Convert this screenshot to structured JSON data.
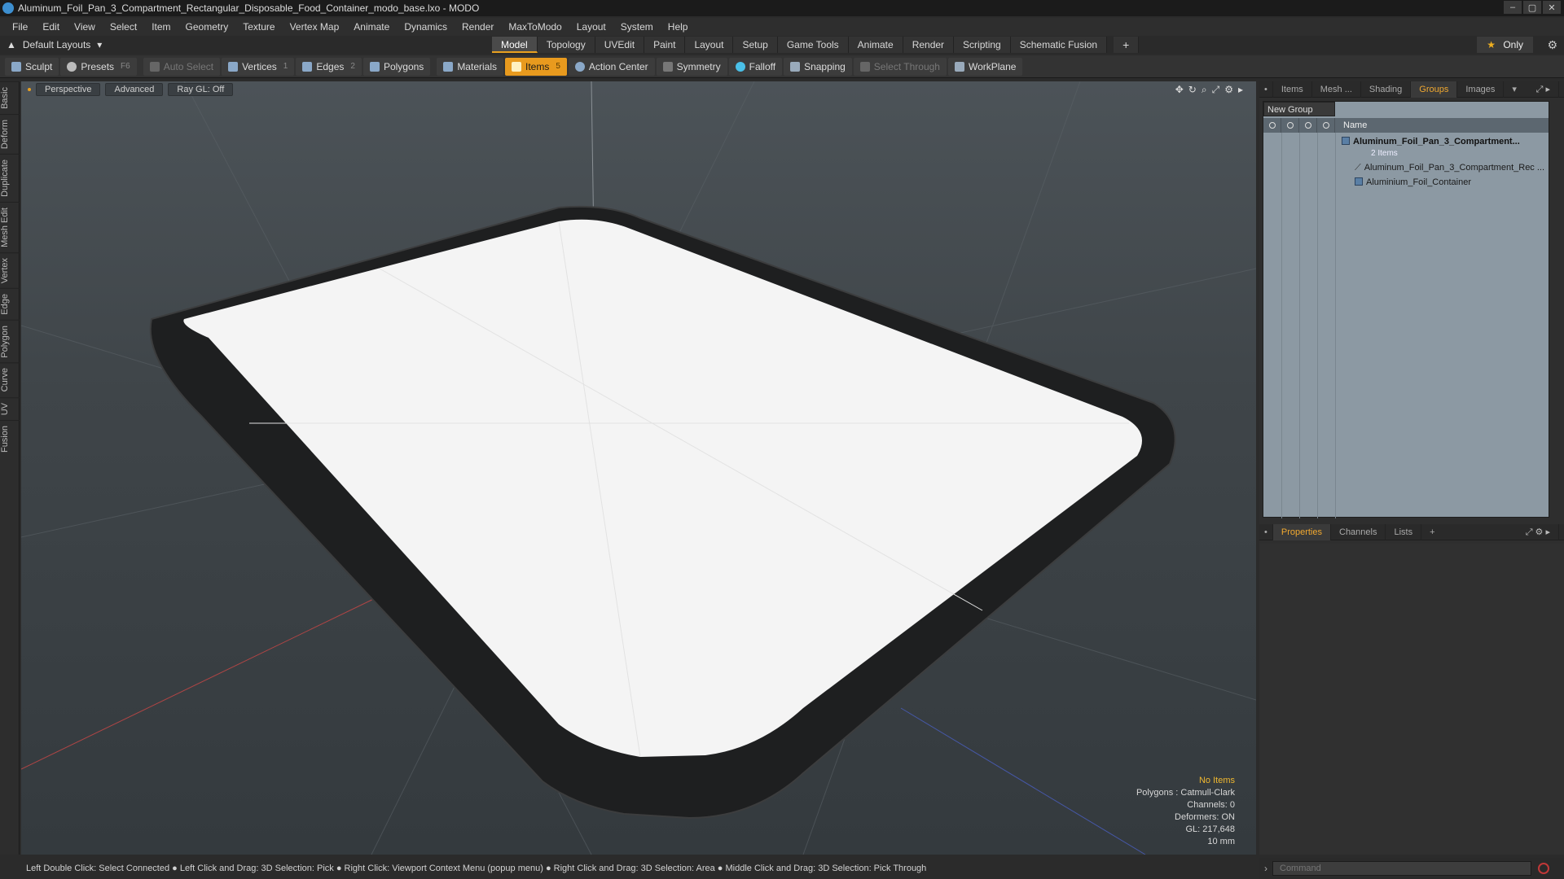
{
  "window": {
    "title": "Aluminum_Foil_Pan_3_Compartment_Rectangular_Disposable_Food_Container_modo_base.lxo - MODO",
    "controls": [
      "–",
      "▢",
      "✕"
    ]
  },
  "menu": [
    "File",
    "Edit",
    "View",
    "Select",
    "Item",
    "Geometry",
    "Texture",
    "Vertex Map",
    "Animate",
    "Dynamics",
    "Render",
    "MaxToModo",
    "Layout",
    "System",
    "Help"
  ],
  "layout": {
    "menu_label": "Default Layouts",
    "tabs": [
      "Model",
      "Topology",
      "UVEdit",
      "Paint",
      "Layout",
      "Setup",
      "Game Tools",
      "Animate",
      "Render",
      "Scripting",
      "Schematic Fusion"
    ],
    "active_tab": "Model",
    "only_label": "Only"
  },
  "toolbar": {
    "sculpt": "Sculpt",
    "presets": "Presets",
    "presets_key": "F6",
    "auto_select": "Auto Select",
    "vertices": "Vertices",
    "vertices_num": "1",
    "edges": "Edges",
    "edges_num": "2",
    "polygons": "Polygons",
    "materials": "Materials",
    "items": "Items",
    "items_num": "5",
    "action_center": "Action Center",
    "symmetry": "Symmetry",
    "falloff": "Falloff",
    "snapping": "Snapping",
    "select_through": "Select Through",
    "workplane": "WorkPlane"
  },
  "left_tabs": [
    "Basic",
    "Deform",
    "Duplicate",
    "Mesh Edit",
    "Vertex",
    "Edge",
    "Polygon",
    "Curve",
    "UV",
    "Fusion"
  ],
  "viewport": {
    "perspective": "Perspective",
    "advanced": "Advanced",
    "raygl": "Ray GL: Off",
    "info": {
      "no_items": "No Items",
      "polygons": "Polygons : Catmull-Clark",
      "channels": "Channels: 0",
      "deformers": "Deformers: ON",
      "gl": "GL: 217,648",
      "scale": "10 mm"
    }
  },
  "panel_top": {
    "tabs": [
      "Items",
      "Mesh ...",
      "Shading",
      "Groups",
      "Images"
    ],
    "active": "Groups",
    "new_group": "New Group",
    "col_name": "Name",
    "group_name": "Aluminum_Foil_Pan_3_Compartment...",
    "group_count": "2 Items",
    "child_1": "Aluminum_Foil_Pan_3_Compartment_Rec ...",
    "child_2": "Aluminium_Foil_Container"
  },
  "panel_bottom": {
    "tabs": [
      "Properties",
      "Channels",
      "Lists"
    ],
    "active": "Properties"
  },
  "command": {
    "placeholder": "Command"
  },
  "status": "Left Double Click: Select Connected ● Left Click and Drag: 3D Selection: Pick ● Right Click: Viewport Context Menu (popup menu) ● Right Click and Drag: 3D Selection: Area ● Middle Click and Drag: 3D Selection: Pick Through"
}
